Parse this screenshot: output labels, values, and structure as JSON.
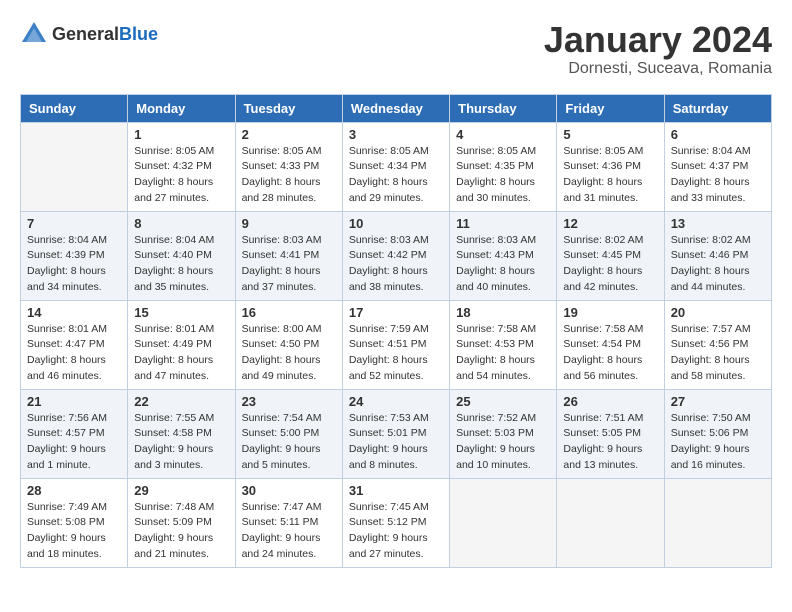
{
  "header": {
    "logo_general": "General",
    "logo_blue": "Blue",
    "month": "January 2024",
    "location": "Dornesti, Suceava, Romania"
  },
  "days_of_week": [
    "Sunday",
    "Monday",
    "Tuesday",
    "Wednesday",
    "Thursday",
    "Friday",
    "Saturday"
  ],
  "weeks": [
    [
      {
        "day": "",
        "sunrise": "",
        "sunset": "",
        "daylight": "",
        "empty": true
      },
      {
        "day": "1",
        "sunrise": "Sunrise: 8:05 AM",
        "sunset": "Sunset: 4:32 PM",
        "daylight": "Daylight: 8 hours and 27 minutes."
      },
      {
        "day": "2",
        "sunrise": "Sunrise: 8:05 AM",
        "sunset": "Sunset: 4:33 PM",
        "daylight": "Daylight: 8 hours and 28 minutes."
      },
      {
        "day": "3",
        "sunrise": "Sunrise: 8:05 AM",
        "sunset": "Sunset: 4:34 PM",
        "daylight": "Daylight: 8 hours and 29 minutes."
      },
      {
        "day": "4",
        "sunrise": "Sunrise: 8:05 AM",
        "sunset": "Sunset: 4:35 PM",
        "daylight": "Daylight: 8 hours and 30 minutes."
      },
      {
        "day": "5",
        "sunrise": "Sunrise: 8:05 AM",
        "sunset": "Sunset: 4:36 PM",
        "daylight": "Daylight: 8 hours and 31 minutes."
      },
      {
        "day": "6",
        "sunrise": "Sunrise: 8:04 AM",
        "sunset": "Sunset: 4:37 PM",
        "daylight": "Daylight: 8 hours and 33 minutes."
      }
    ],
    [
      {
        "day": "7",
        "sunrise": "Sunrise: 8:04 AM",
        "sunset": "Sunset: 4:39 PM",
        "daylight": "Daylight: 8 hours and 34 minutes."
      },
      {
        "day": "8",
        "sunrise": "Sunrise: 8:04 AM",
        "sunset": "Sunset: 4:40 PM",
        "daylight": "Daylight: 8 hours and 35 minutes."
      },
      {
        "day": "9",
        "sunrise": "Sunrise: 8:03 AM",
        "sunset": "Sunset: 4:41 PM",
        "daylight": "Daylight: 8 hours and 37 minutes."
      },
      {
        "day": "10",
        "sunrise": "Sunrise: 8:03 AM",
        "sunset": "Sunset: 4:42 PM",
        "daylight": "Daylight: 8 hours and 38 minutes."
      },
      {
        "day": "11",
        "sunrise": "Sunrise: 8:03 AM",
        "sunset": "Sunset: 4:43 PM",
        "daylight": "Daylight: 8 hours and 40 minutes."
      },
      {
        "day": "12",
        "sunrise": "Sunrise: 8:02 AM",
        "sunset": "Sunset: 4:45 PM",
        "daylight": "Daylight: 8 hours and 42 minutes."
      },
      {
        "day": "13",
        "sunrise": "Sunrise: 8:02 AM",
        "sunset": "Sunset: 4:46 PM",
        "daylight": "Daylight: 8 hours and 44 minutes."
      }
    ],
    [
      {
        "day": "14",
        "sunrise": "Sunrise: 8:01 AM",
        "sunset": "Sunset: 4:47 PM",
        "daylight": "Daylight: 8 hours and 46 minutes."
      },
      {
        "day": "15",
        "sunrise": "Sunrise: 8:01 AM",
        "sunset": "Sunset: 4:49 PM",
        "daylight": "Daylight: 8 hours and 47 minutes."
      },
      {
        "day": "16",
        "sunrise": "Sunrise: 8:00 AM",
        "sunset": "Sunset: 4:50 PM",
        "daylight": "Daylight: 8 hours and 49 minutes."
      },
      {
        "day": "17",
        "sunrise": "Sunrise: 7:59 AM",
        "sunset": "Sunset: 4:51 PM",
        "daylight": "Daylight: 8 hours and 52 minutes."
      },
      {
        "day": "18",
        "sunrise": "Sunrise: 7:58 AM",
        "sunset": "Sunset: 4:53 PM",
        "daylight": "Daylight: 8 hours and 54 minutes."
      },
      {
        "day": "19",
        "sunrise": "Sunrise: 7:58 AM",
        "sunset": "Sunset: 4:54 PM",
        "daylight": "Daylight: 8 hours and 56 minutes."
      },
      {
        "day": "20",
        "sunrise": "Sunrise: 7:57 AM",
        "sunset": "Sunset: 4:56 PM",
        "daylight": "Daylight: 8 hours and 58 minutes."
      }
    ],
    [
      {
        "day": "21",
        "sunrise": "Sunrise: 7:56 AM",
        "sunset": "Sunset: 4:57 PM",
        "daylight": "Daylight: 9 hours and 1 minute."
      },
      {
        "day": "22",
        "sunrise": "Sunrise: 7:55 AM",
        "sunset": "Sunset: 4:58 PM",
        "daylight": "Daylight: 9 hours and 3 minutes."
      },
      {
        "day": "23",
        "sunrise": "Sunrise: 7:54 AM",
        "sunset": "Sunset: 5:00 PM",
        "daylight": "Daylight: 9 hours and 5 minutes."
      },
      {
        "day": "24",
        "sunrise": "Sunrise: 7:53 AM",
        "sunset": "Sunset: 5:01 PM",
        "daylight": "Daylight: 9 hours and 8 minutes."
      },
      {
        "day": "25",
        "sunrise": "Sunrise: 7:52 AM",
        "sunset": "Sunset: 5:03 PM",
        "daylight": "Daylight: 9 hours and 10 minutes."
      },
      {
        "day": "26",
        "sunrise": "Sunrise: 7:51 AM",
        "sunset": "Sunset: 5:05 PM",
        "daylight": "Daylight: 9 hours and 13 minutes."
      },
      {
        "day": "27",
        "sunrise": "Sunrise: 7:50 AM",
        "sunset": "Sunset: 5:06 PM",
        "daylight": "Daylight: 9 hours and 16 minutes."
      }
    ],
    [
      {
        "day": "28",
        "sunrise": "Sunrise: 7:49 AM",
        "sunset": "Sunset: 5:08 PM",
        "daylight": "Daylight: 9 hours and 18 minutes."
      },
      {
        "day": "29",
        "sunrise": "Sunrise: 7:48 AM",
        "sunset": "Sunset: 5:09 PM",
        "daylight": "Daylight: 9 hours and 21 minutes."
      },
      {
        "day": "30",
        "sunrise": "Sunrise: 7:47 AM",
        "sunset": "Sunset: 5:11 PM",
        "daylight": "Daylight: 9 hours and 24 minutes."
      },
      {
        "day": "31",
        "sunrise": "Sunrise: 7:45 AM",
        "sunset": "Sunset: 5:12 PM",
        "daylight": "Daylight: 9 hours and 27 minutes."
      },
      {
        "day": "",
        "sunrise": "",
        "sunset": "",
        "daylight": "",
        "empty": true
      },
      {
        "day": "",
        "sunrise": "",
        "sunset": "",
        "daylight": "",
        "empty": true
      },
      {
        "day": "",
        "sunrise": "",
        "sunset": "",
        "daylight": "",
        "empty": true
      }
    ]
  ]
}
